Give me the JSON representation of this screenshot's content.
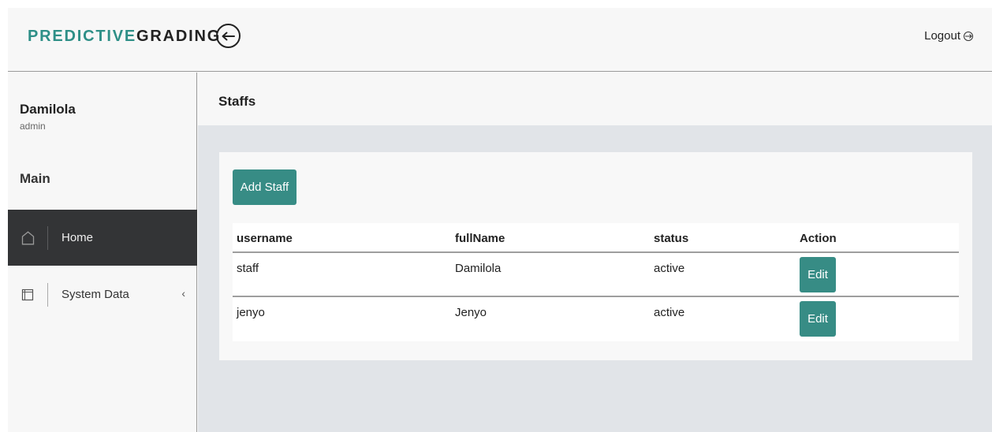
{
  "header": {
    "brand_part1": "PREDICTIVE",
    "brand_part2": "GRADING",
    "logout_label": "Logout",
    "brand_color": "#2e8f87"
  },
  "sidebar": {
    "user_name": "Damilola",
    "user_role": "admin",
    "section_title": "Main",
    "items": [
      {
        "label": "Home",
        "icon": "home-icon",
        "active": true
      },
      {
        "label": "System Data",
        "icon": "book-icon",
        "expandable": true
      }
    ]
  },
  "main": {
    "title": "Staffs",
    "add_button": "Add Staff",
    "accent_color": "#378c85",
    "table": {
      "columns": [
        "username",
        "fullName",
        "status",
        "Action"
      ],
      "rows": [
        {
          "username": "staff",
          "fullName": "Damilola",
          "status": "active",
          "action": "Edit"
        },
        {
          "username": "jenyo",
          "fullName": "Jenyo",
          "status": "active",
          "action": "Edit"
        }
      ]
    }
  }
}
